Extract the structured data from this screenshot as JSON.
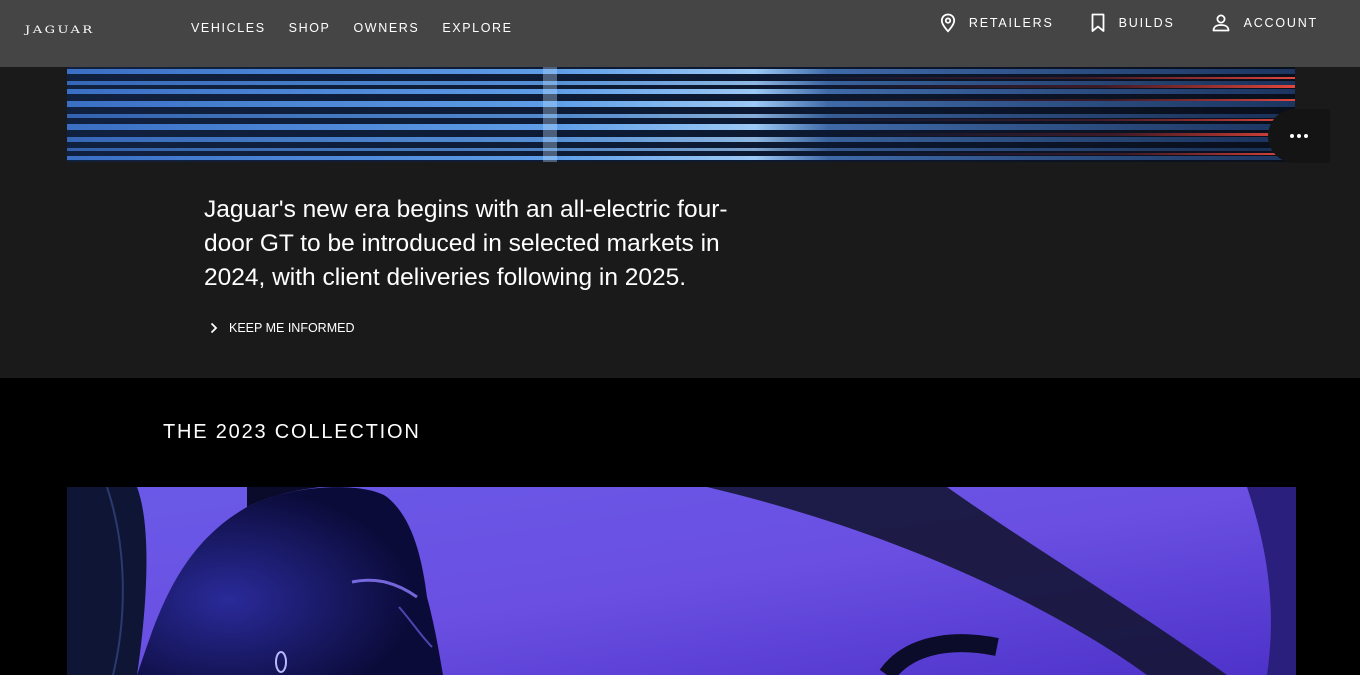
{
  "header": {
    "logo": "JAGUAR",
    "nav": [
      {
        "label": "VEHICLES"
      },
      {
        "label": "SHOP"
      },
      {
        "label": "OWNERS"
      },
      {
        "label": "EXPLORE"
      }
    ],
    "utility": {
      "retailers": "RETAILERS",
      "builds": "BUILDS",
      "account": "ACCOUNT"
    }
  },
  "hero": {
    "copy": "Jaguar's new era begins with an all-electric four-door GT to be introduced in selected markets in 2024, with client deliveries following in 2025.",
    "cta": "KEEP ME INFORMED"
  },
  "collection": {
    "title": "THE 2023 COLLECTION"
  },
  "colors": {
    "header_bg": "#454545",
    "hero_bg": "#1a1a1b",
    "page_bg": "#000000",
    "accent_blue": "#4a8fe0",
    "accent_red": "#d1332e",
    "purple": "#6b4ee6"
  }
}
